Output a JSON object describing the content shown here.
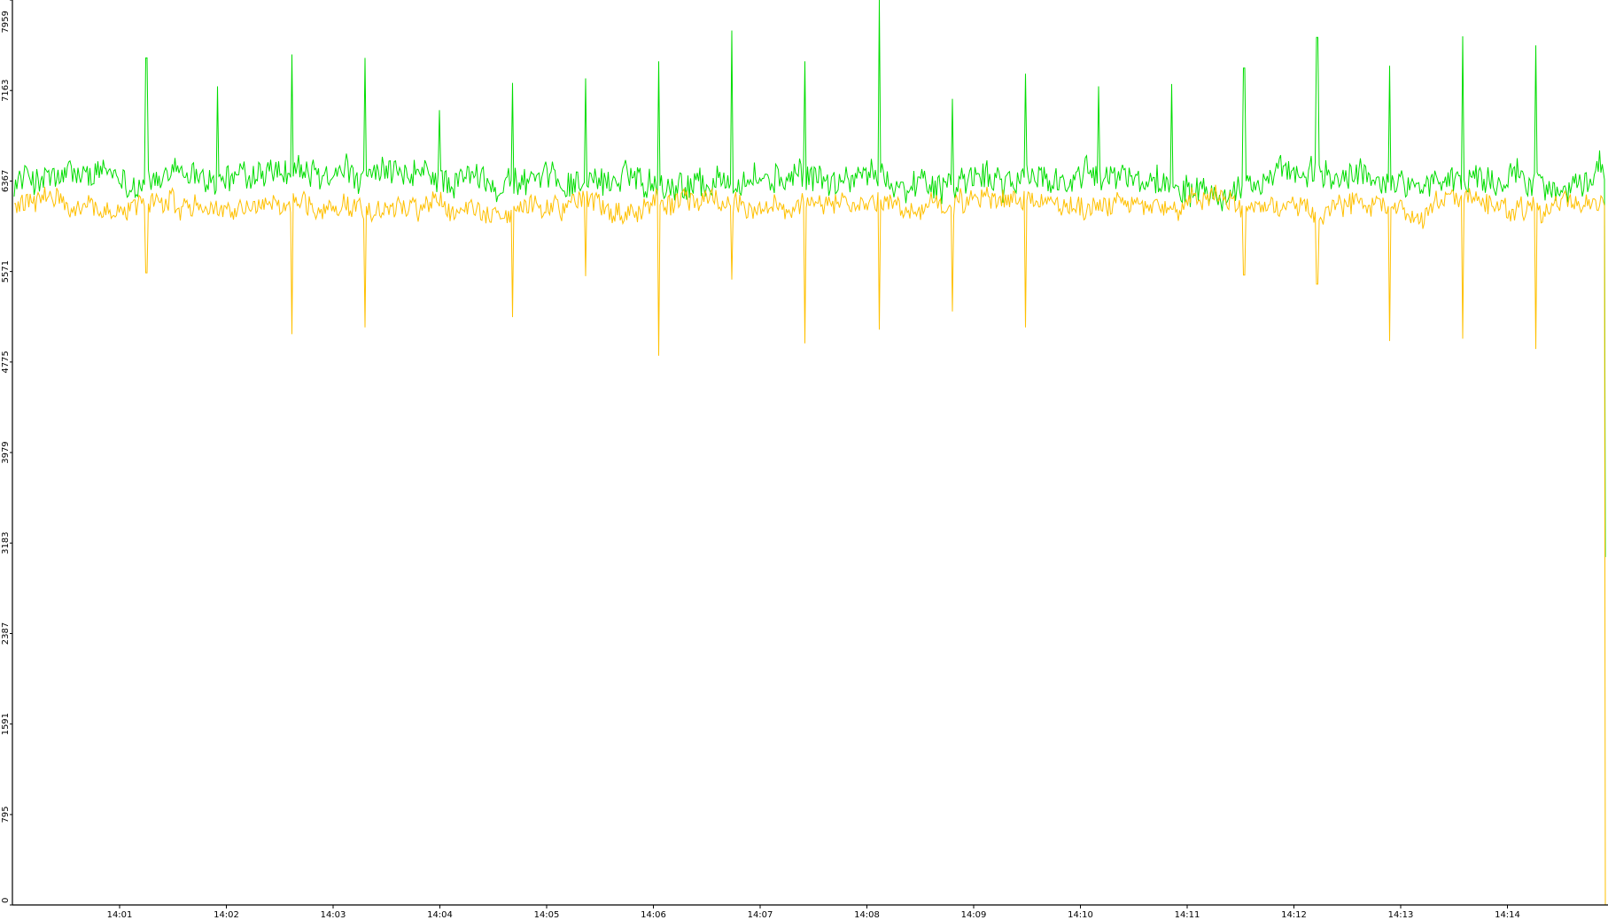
{
  "chart_data": {
    "type": "line",
    "title": "",
    "xlabel": "",
    "ylabel": "",
    "ylim": [
      0,
      7959
    ],
    "y_ticks": [
      "0",
      "795",
      "1591",
      "2387",
      "3183",
      "3979",
      "4775",
      "5571",
      "6367",
      "7163",
      "7959"
    ],
    "x_ticks": [
      "14:01",
      "14:02",
      "14:03",
      "14:04",
      "14:05",
      "14:06",
      "14:07",
      "14:08",
      "14:09",
      "14:10",
      "14:11",
      "14:12",
      "14:13",
      "14:14"
    ],
    "grid": false,
    "legend": "none",
    "x_range_minutes": [
      14.1,
      15.0
    ],
    "series": [
      {
        "color": "#00dd00",
        "baseline": 6380,
        "noise": 230,
        "spike_times": [
          "14:01:15",
          "14:01:55",
          "14:02:37",
          "14:03:18",
          "14:04:00",
          "14:04:41",
          "14:05:22",
          "14:06:03",
          "14:06:44",
          "14:07:25",
          "14:08:07",
          "14:08:48",
          "14:09:29",
          "14:10:10",
          "14:10:51",
          "14:11:32",
          "14:12:13",
          "14:12:54",
          "14:13:35",
          "14:14:16",
          "14:14:57"
        ],
        "spike_values": [
          7450,
          7200,
          7480,
          7450,
          6990,
          7230,
          7270,
          7420,
          7690,
          7420,
          7959,
          7090,
          7310,
          7200,
          7220,
          7360,
          7630,
          7380,
          7640,
          7560,
          7160
        ],
        "end_value": 3060
      },
      {
        "color": "#ffc000",
        "baseline": 6150,
        "noise": 180,
        "dip_times": [
          "14:01:15",
          "14:02:37",
          "14:03:18",
          "14:04:41",
          "14:05:22",
          "14:06:03",
          "14:06:44",
          "14:07:25",
          "14:08:07",
          "14:08:48",
          "14:09:29",
          "14:11:32",
          "14:12:13",
          "14:12:54",
          "14:13:35",
          "14:14:16"
        ],
        "dip_values": [
          5560,
          5020,
          5080,
          5170,
          5530,
          4830,
          5500,
          4940,
          5060,
          5220,
          5080,
          5540,
          5460,
          4960,
          4980,
          4890
        ],
        "end_value": 0
      }
    ]
  },
  "colors": {
    "background": "#ffffff",
    "axis": "#000000",
    "series_green": "#00dd00",
    "series_orange": "#ffc000"
  }
}
